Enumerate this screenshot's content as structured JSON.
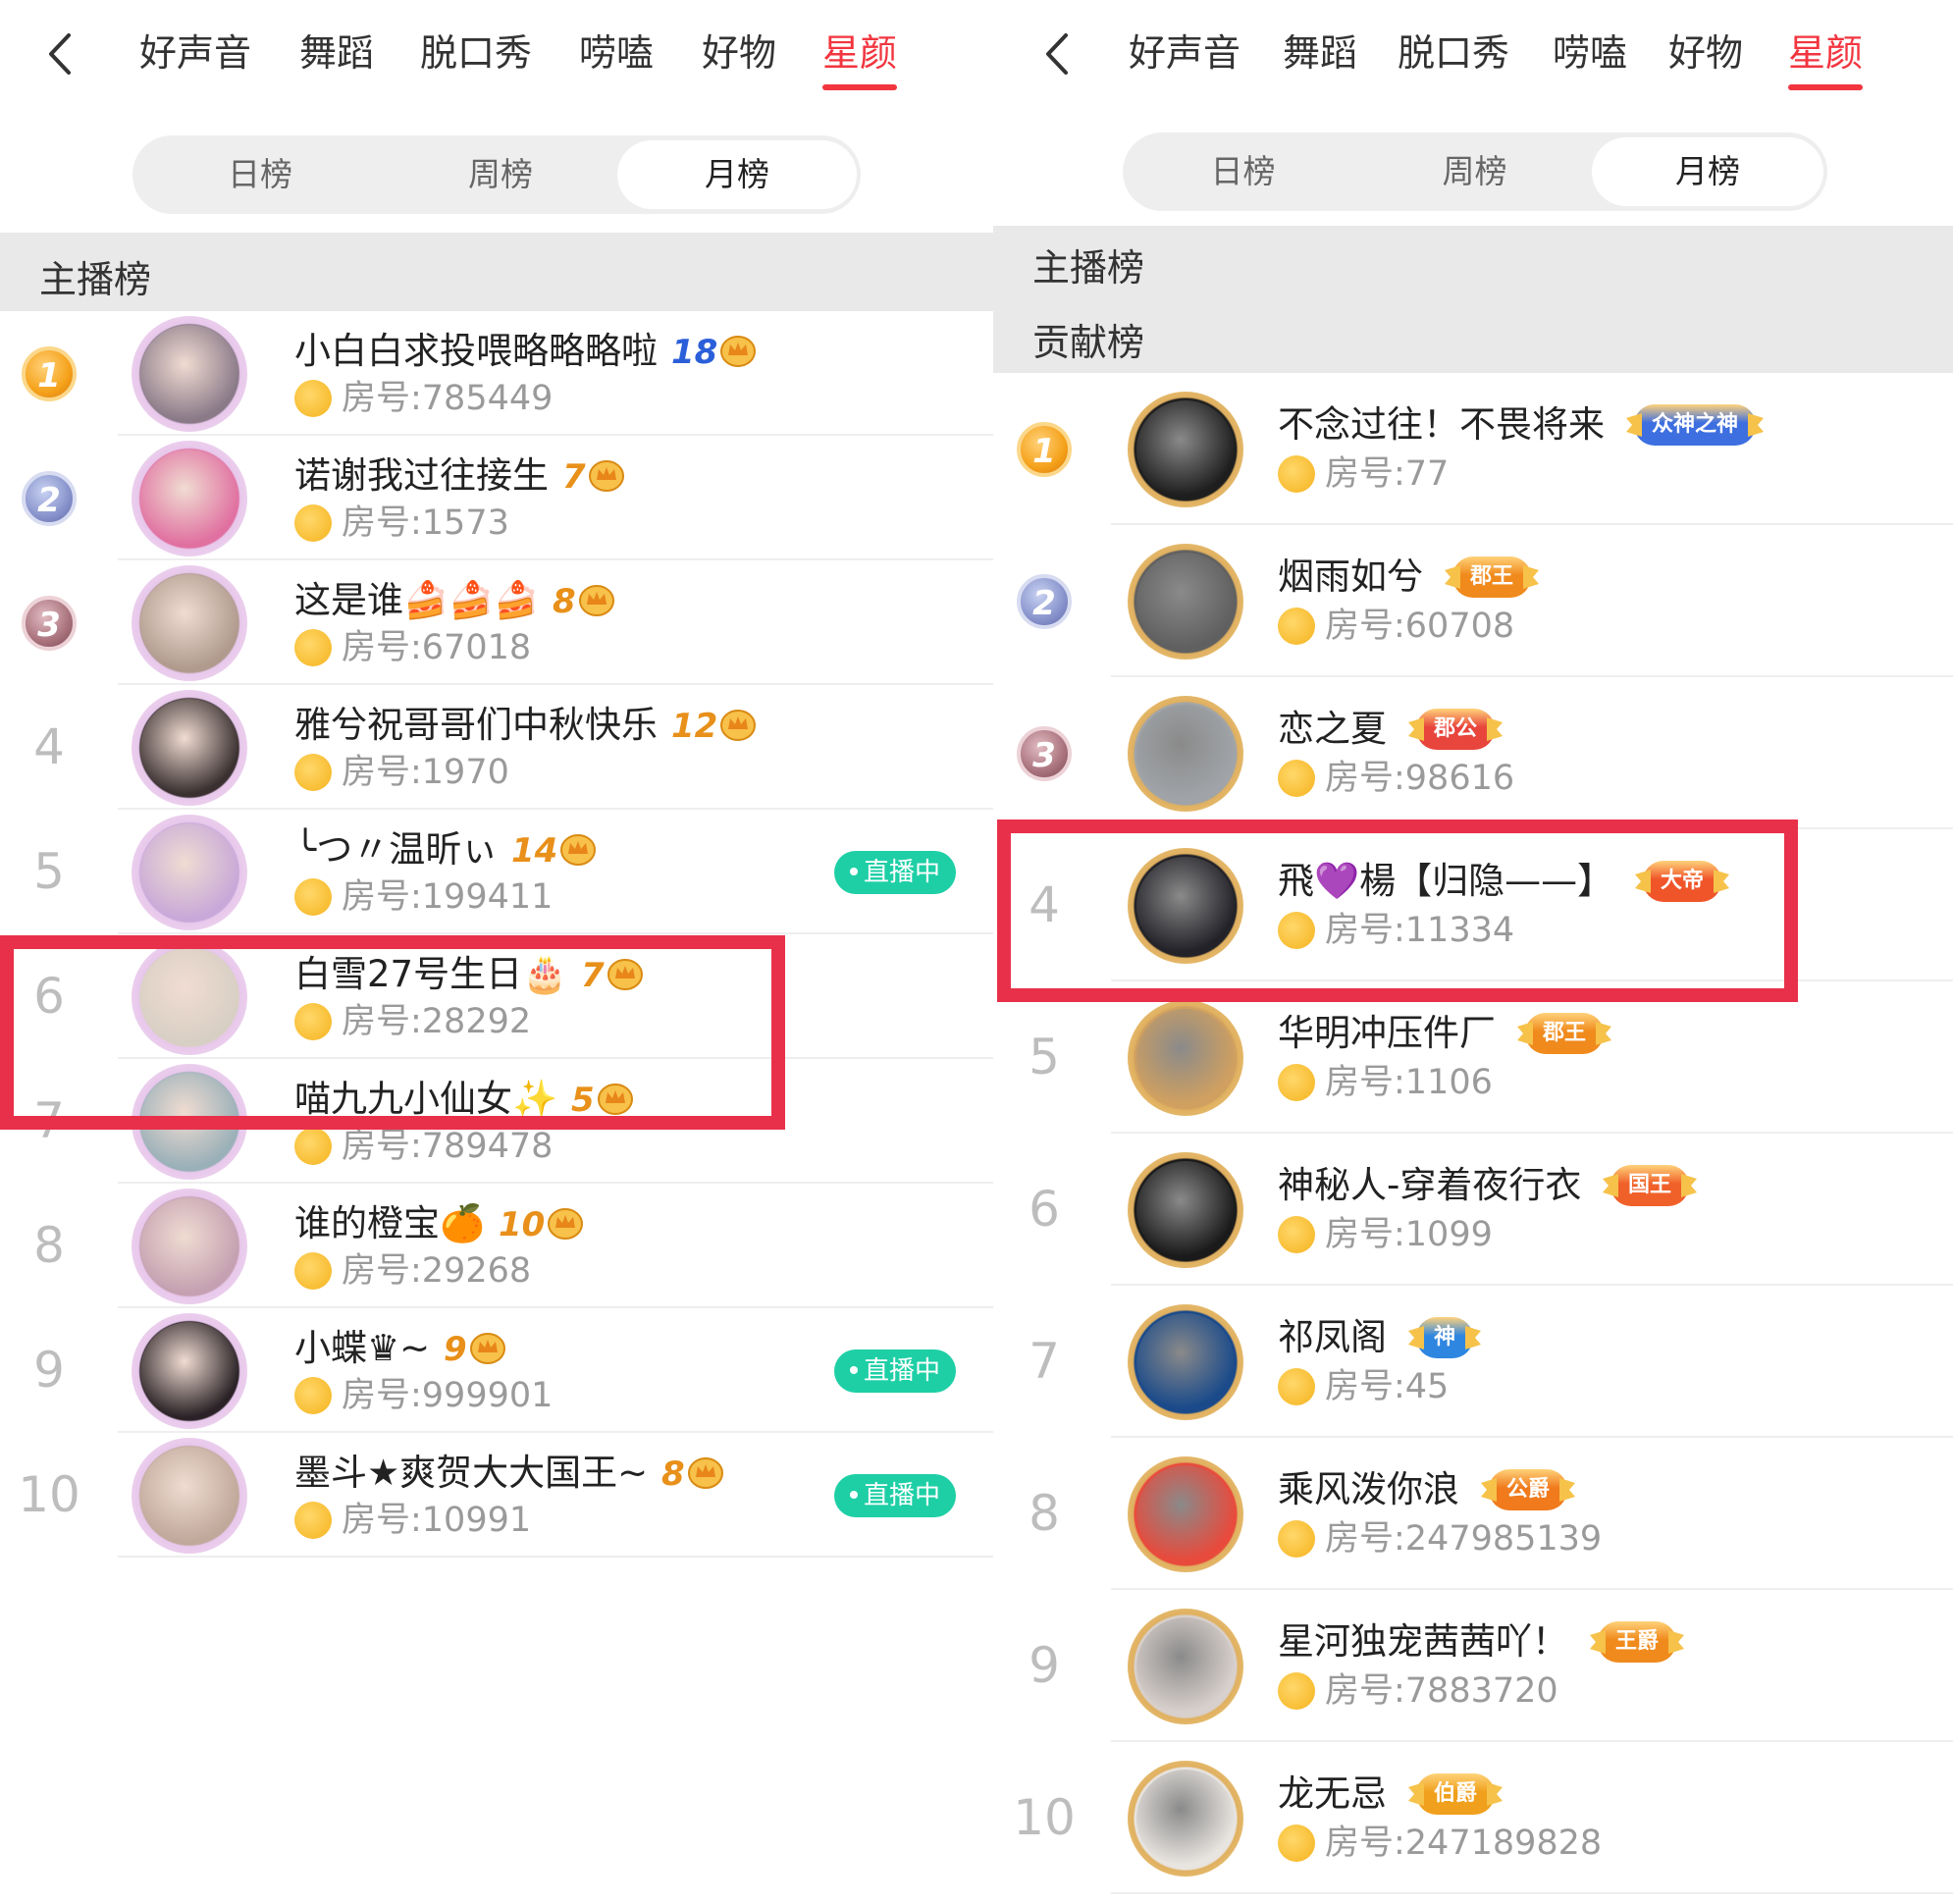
{
  "nav_tabs": [
    "好声音",
    "舞蹈",
    "脱口秀",
    "唠嗑",
    "好物",
    "星颜"
  ],
  "active_tab_index": 5,
  "segments": [
    "日榜",
    "周榜",
    "月榜"
  ],
  "active_segment_index": 2,
  "colors": {
    "accent": "#f2353f",
    "highlight": "#e8304a",
    "live": "#1ecfa6",
    "level_blue": "#2b5fd9",
    "level_gold": "#e8901a"
  },
  "left": {
    "section_title": "主播榜",
    "rows": [
      {
        "rank": "1",
        "name": "小白白求投喂略略略啦",
        "level": "18",
        "room": "房号:785449",
        "live": ""
      },
      {
        "rank": "2",
        "name": "诺谢我过往接生",
        "level": "7",
        "room": "房号:1573",
        "live": ""
      },
      {
        "rank": "3",
        "name": "这是谁🍰🍰🍰",
        "level": "8",
        "room": "房号:67018",
        "live": ""
      },
      {
        "rank": "4",
        "name": "雅兮祝哥哥们中秋快乐",
        "level": "12",
        "room": "房号:1970",
        "live": ""
      },
      {
        "rank": "5",
        "name": "╰つ〃温昕ぃ",
        "level": "14",
        "room": "房号:199411",
        "live": "直播中"
      },
      {
        "rank": "6",
        "name": "白雪27号生日🎂",
        "level": "7",
        "room": "房号:28292",
        "live": ""
      },
      {
        "rank": "7",
        "name": "喵九九小仙女✨",
        "level": "5",
        "room": "房号:789478",
        "live": ""
      },
      {
        "rank": "8",
        "name": "谁的橙宝🍊",
        "level": "10",
        "room": "房号:29268",
        "live": ""
      },
      {
        "rank": "9",
        "name": "小蝶♛~",
        "level": "9",
        "room": "房号:999901",
        "live": "直播中"
      },
      {
        "rank": "10",
        "name": "墨斗★爽贺大大国王~",
        "level": "8",
        "room": "房号:10991",
        "live": "直播中"
      }
    ]
  },
  "right": {
    "section_title_1": "主播榜",
    "section_title_2": "贡献榜",
    "rows": [
      {
        "rank": "1",
        "name": "不念过往！不畏将来",
        "badge": "众神之神",
        "badge_color": "#3d6fe0",
        "room": "房号:77"
      },
      {
        "rank": "2",
        "name": "烟雨如兮",
        "badge": "郡王",
        "badge_color": "#f08a1c",
        "room": "房号:60708"
      },
      {
        "rank": "3",
        "name": "恋之夏",
        "badge": "郡公",
        "badge_color": "#e8453c",
        "room": "房号:98616"
      },
      {
        "rank": "4",
        "name": "飛💜楊【归隐——】",
        "badge": "大帝",
        "badge_color": "#f0552a",
        "room": "房号:11334"
      },
      {
        "rank": "5",
        "name": "华明冲压件厂",
        "badge": "郡王",
        "badge_color": "#f08a1c",
        "room": "房号:1106"
      },
      {
        "rank": "6",
        "name": "神秘人-穿着夜行衣",
        "badge": "国王",
        "badge_color": "#f0612a",
        "room": "房号:1099"
      },
      {
        "rank": "7",
        "name": "祁凤阁",
        "badge": "神",
        "badge_color": "#2f86e0",
        "room": "房号:45"
      },
      {
        "rank": "8",
        "name": "乘风泼你浪",
        "badge": "公爵",
        "badge_color": "#f07a1c",
        "room": "房号:247985139"
      },
      {
        "rank": "9",
        "name": "星河独宠茜茜吖！",
        "badge": "王爵",
        "badge_color": "#f08a1c",
        "room": "房号:7883720"
      },
      {
        "rank": "10",
        "name": "龙无忌",
        "badge": "伯爵",
        "badge_color": "#f0a01c",
        "room": "房号:247189828"
      }
    ]
  },
  "avatar_colors_left": [
    "#8a7a88",
    "#e070a0",
    "#b09a8e",
    "#3a3030",
    "#c8a8d8",
    "#d8cfc4",
    "#9ab0b8",
    "#c4a0b0",
    "#2a2226",
    "#c0a89a"
  ],
  "avatar_colors_right": [
    "#1e1e1e",
    "#606060",
    "#a0a4a8",
    "#222228",
    "#d0a060",
    "#1a1a1a",
    "#1a4a8a",
    "#e84a3c",
    "#d8d0cc",
    "#e8e4e0"
  ]
}
